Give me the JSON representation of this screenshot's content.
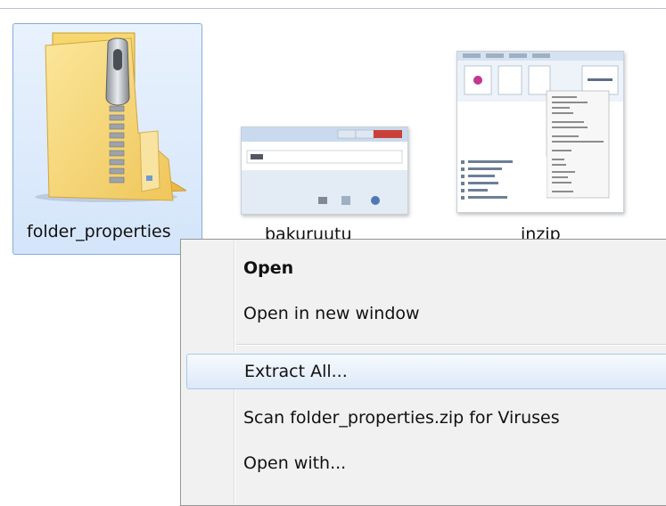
{
  "files": [
    {
      "name": "folder_properties",
      "icon": "zip-folder-icon",
      "selected": true
    },
    {
      "name": "bakuruutu",
      "icon": "window-thumbnail-icon",
      "selected": false
    },
    {
      "name": "inzip",
      "icon": "window-thumbnail-icon",
      "selected": false
    }
  ],
  "context_menu": {
    "items": [
      {
        "label": "Open",
        "bold": true
      },
      {
        "label": "Open in new window"
      },
      {
        "label": "Extract All...",
        "hover": true
      },
      {
        "label": "Scan folder_properties.zip for Viruses"
      },
      {
        "label": "Open with..."
      }
    ]
  },
  "colors": {
    "selection_fill": "#d9e8fb",
    "selection_border": "#84acdd",
    "menu_background": "#f1f1f1",
    "menu_hover_fill": "#e4eefb",
    "folder_yellow": "#f4cf5f"
  }
}
